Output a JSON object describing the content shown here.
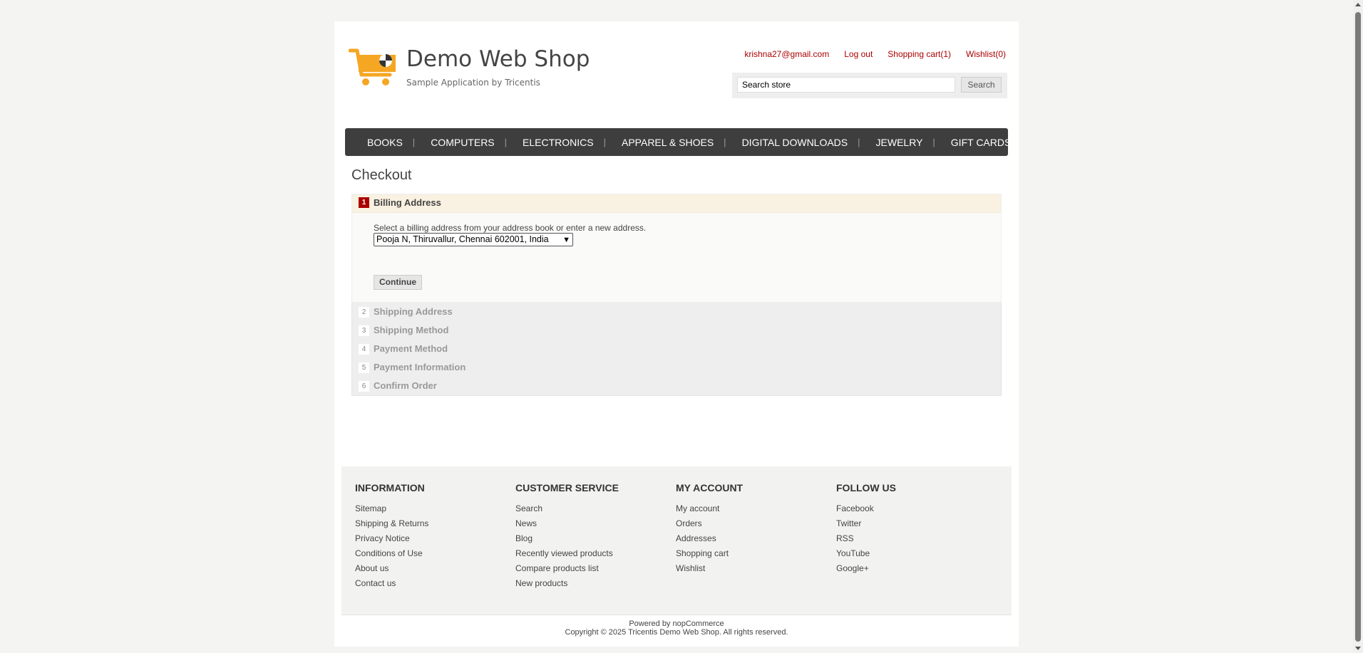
{
  "header": {
    "logo_title": "Demo Web Shop",
    "logo_subtitle": "Sample Application by Tricentis",
    "links": {
      "account": "krishna27@gmail.com",
      "logout": "Log out",
      "cart": "Shopping cart(1)",
      "wishlist": "Wishlist(0)"
    },
    "search": {
      "value": "Search store",
      "button": "Search"
    }
  },
  "menu": {
    "items": [
      "BOOKS",
      "COMPUTERS",
      "ELECTRONICS",
      "APPAREL & SHOES",
      "DIGITAL DOWNLOADS",
      "JEWELRY",
      "GIFT CARDS"
    ]
  },
  "checkout": {
    "title": "Checkout",
    "active_step": {
      "number": "1",
      "title": "Billing Address",
      "hint": "Select a billing address from your address book or enter a new address.",
      "selected_address": "Pooja N, Thiruvallur, Chennai 602001, India",
      "continue": "Continue"
    },
    "steps": [
      {
        "number": "2",
        "title": "Shipping Address"
      },
      {
        "number": "3",
        "title": "Shipping Method"
      },
      {
        "number": "4",
        "title": "Payment Method"
      },
      {
        "number": "5",
        "title": "Payment Information"
      },
      {
        "number": "6",
        "title": "Confirm Order"
      }
    ]
  },
  "footer": {
    "columns": [
      {
        "title": "INFORMATION",
        "links": [
          "Sitemap",
          "Shipping & Returns",
          "Privacy Notice",
          "Conditions of Use",
          "About us",
          "Contact us"
        ]
      },
      {
        "title": "CUSTOMER SERVICE",
        "links": [
          "Search",
          "News",
          "Blog",
          "Recently viewed products",
          "Compare products list",
          "New products"
        ]
      },
      {
        "title": "MY ACCOUNT",
        "links": [
          "My account",
          "Orders",
          "Addresses",
          "Shopping cart",
          "Wishlist"
        ]
      },
      {
        "title": "FOLLOW US",
        "links": [
          "Facebook",
          "Twitter",
          "RSS",
          "YouTube",
          "Google+"
        ]
      }
    ],
    "powered_by": "Powered by nopCommerce",
    "copyright": "Copyright © 2025 Tricentis Demo Web Shop. All rights reserved."
  },
  "colors": {
    "accent": "#aa0000",
    "menu_bg": "#3e3e3e",
    "logo": "#f5a623"
  }
}
